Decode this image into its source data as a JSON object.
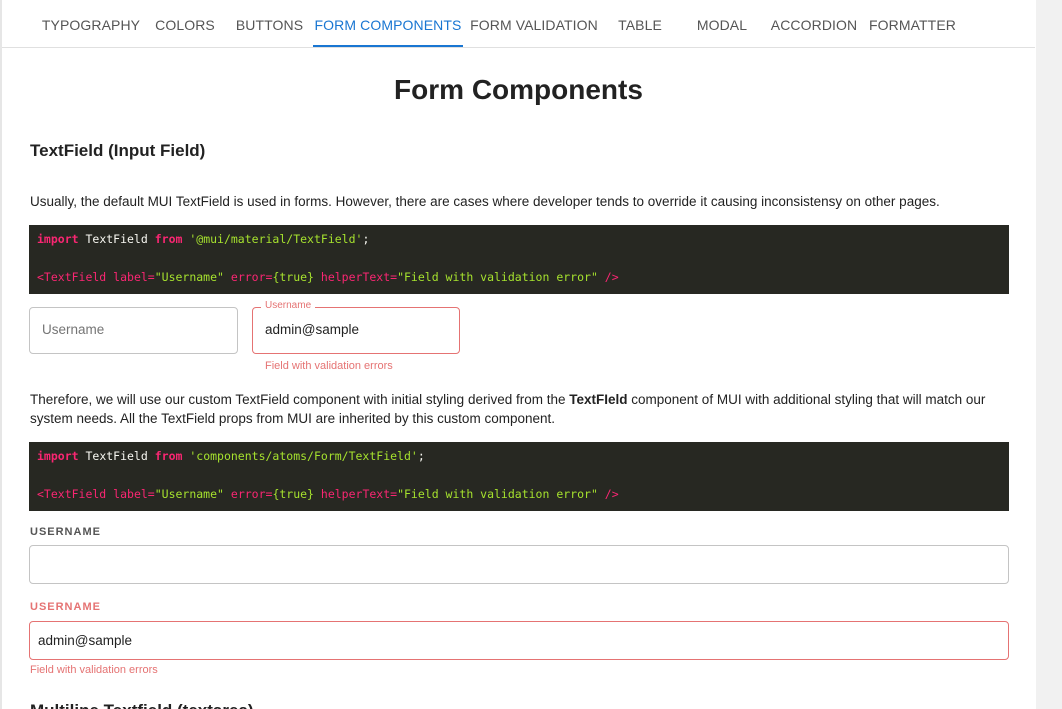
{
  "nav": {
    "tabs": [
      {
        "label": "TYPOGRAPHY"
      },
      {
        "label": "COLORS"
      },
      {
        "label": "BUTTONS"
      },
      {
        "label": "FORM COMPONENTS"
      },
      {
        "label": "FORM VALIDATION"
      },
      {
        "label": "TABLE"
      },
      {
        "label": "MODAL"
      },
      {
        "label": "ACCORDION"
      },
      {
        "label": "FORMATTER"
      }
    ],
    "active_tab": "FORM COMPONENTS"
  },
  "page": {
    "title": "Form Components"
  },
  "section": {
    "heading": "TextField (Input Field)",
    "intro": "Usually, the default MUI TextField is used in forms. However, there are cases where developer tends to override it causing inconsistensy on other pages.",
    "code1": {
      "import_kw": "import",
      "import_name": " TextField ",
      "from_kw": "from",
      "path": " '@mui/material/TextField'",
      "semi": ";",
      "jsx_open": "<TextField ",
      "attr_label": "label=",
      "val_label": "\"Username\"",
      "attr_error": " error=",
      "val_error": "{true}",
      "attr_helper": " helperText=",
      "val_helper": "\"Field with validation error\"",
      "jsx_close": " />"
    },
    "demo_default": {
      "placeholder": "Username"
    },
    "demo_error": {
      "floating_label": "Username",
      "value": "admin@sample",
      "helper": "Field with validation errors"
    },
    "explain_before": "Therefore, we will use our custom TextField component with initial styling derived from the ",
    "explain_bold": "TextFIeld",
    "explain_after": " component of MUI with additional styling that will match our system needs. All the TextField props from MUI are inherited by this custom component.",
    "code2": {
      "import_kw": "import",
      "import_name": " TextField ",
      "from_kw": "from",
      "path": " 'components/atoms/Form/TextField'",
      "semi": ";",
      "jsx_open": "<TextField ",
      "attr_label": "label=",
      "val_label": "\"Username\"",
      "attr_error": " error=",
      "val_error": "{true}",
      "attr_helper": " helperText=",
      "val_helper": "\"Field with validation error\"",
      "jsx_close": " />"
    },
    "custom_default": {
      "label": "USERNAME",
      "value": ""
    },
    "custom_error": {
      "label": "USERNAME",
      "value": "admin@sample",
      "helper": "Field with validation errors"
    }
  },
  "next_section": {
    "heading": "Multiline Textfield (textarea)"
  },
  "colors": {
    "accent": "#1976d2",
    "error": "#e57373",
    "code_bg": "#272822"
  }
}
